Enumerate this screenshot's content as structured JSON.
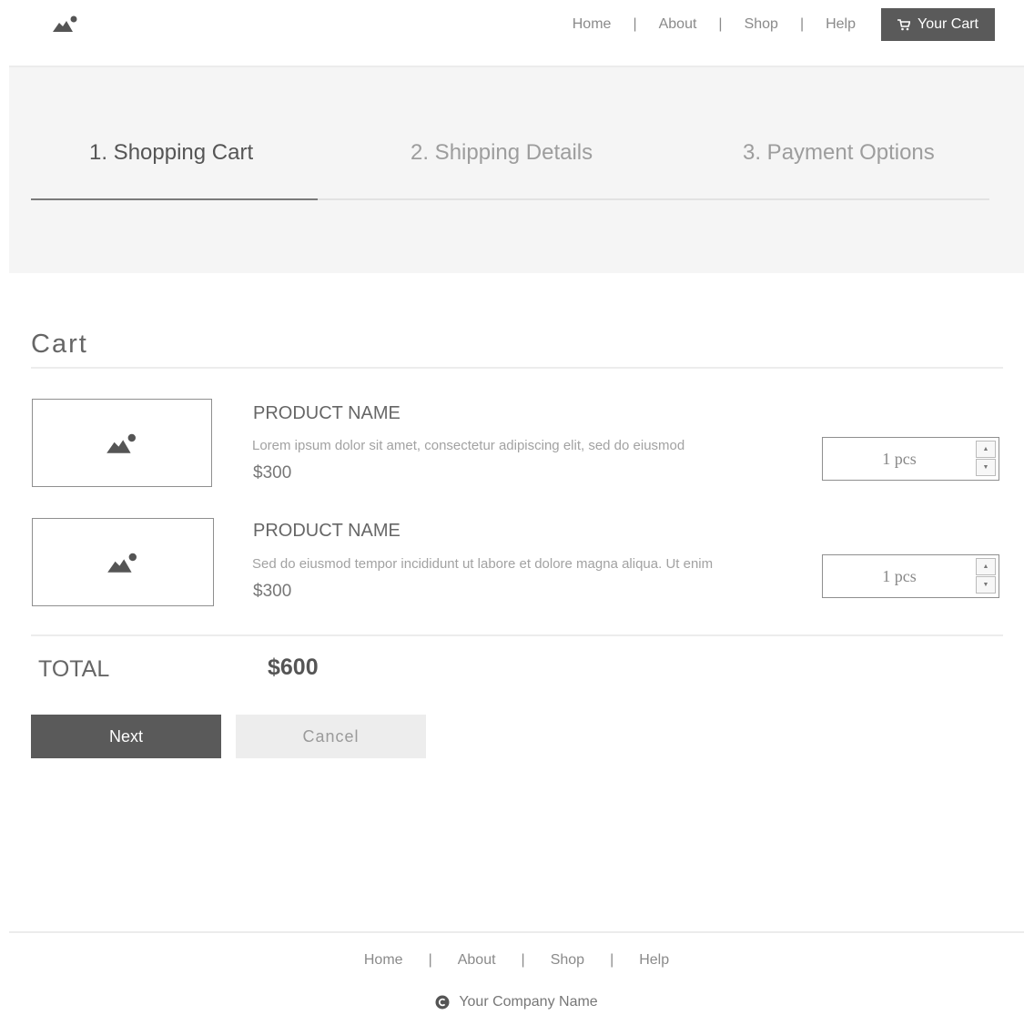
{
  "header": {
    "logo_icon": "image-placeholder-icon",
    "nav": [
      "Home",
      "About",
      "Shop",
      "Help"
    ],
    "separator": "|",
    "cart_label": "Your Cart",
    "cart_icon": "cart-icon"
  },
  "steps": [
    {
      "label": "1. Shopping Cart",
      "active": true
    },
    {
      "label": "2. Shipping Details",
      "active": false
    },
    {
      "label": "3. Payment Options",
      "active": false
    }
  ],
  "cart": {
    "title": "Cart",
    "items": [
      {
        "name": "PRODUCT NAME",
        "description": "Lorem ipsum dolor sit amet, consectetur adipiscing elit, sed do eiusmod",
        "price": "$300",
        "quantity": "1 pcs"
      },
      {
        "name": "PRODUCT NAME",
        "description": "Sed do eiusmod tempor incididunt ut labore et dolore magna aliqua. Ut enim",
        "price": "$300",
        "quantity": "1 pcs"
      }
    ],
    "total_label": "TOTAL",
    "total_value": "$600",
    "next_label": "Next",
    "cancel_label": "Cancel"
  },
  "footer": {
    "nav": [
      "Home",
      "About",
      "Shop",
      "Help"
    ],
    "separator": "|",
    "copyright_icon": "copyright-icon",
    "company": "Your Company Name"
  },
  "colors": {
    "dark": "#5a5a5a",
    "light_bg": "#f5f5f5",
    "muted_text": "#8a8a8a"
  }
}
